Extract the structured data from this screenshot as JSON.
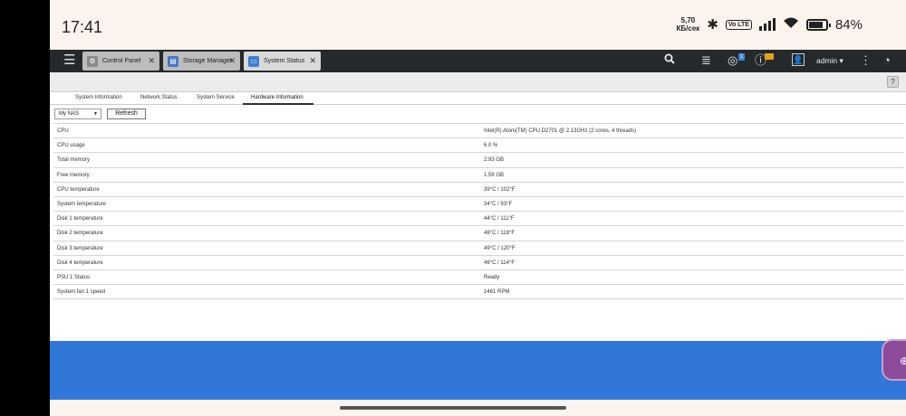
{
  "status_bar": {
    "time": "17:41",
    "speed_value": "5,70",
    "speed_unit": "КБ/сек",
    "volte_label": "Vo LTE",
    "battery_percent": "84%",
    "battery_level": 0.84
  },
  "topbar": {
    "tabs": [
      {
        "label": "Control Panel",
        "icon": "gear-icon",
        "active": false
      },
      {
        "label": "Storage Manager",
        "icon": "storage-icon",
        "active": false
      },
      {
        "label": "System Status",
        "icon": "monitor-icon",
        "active": true
      }
    ],
    "notification_badge": "1",
    "user": "admin"
  },
  "window": {
    "help_label": "?",
    "subtabs": [
      {
        "label": "System Information",
        "active": false
      },
      {
        "label": "Network Status",
        "active": false
      },
      {
        "label": "System Service",
        "active": false
      },
      {
        "label": "Hardware Information",
        "active": true
      }
    ]
  },
  "controls": {
    "nas_select": "My NAS",
    "refresh_label": "Refresh"
  },
  "hardware": [
    {
      "label": "CPU",
      "value": "Intel(R) Atom(TM) CPU D2701 @ 2.13GHz (2 cores, 4 threads)"
    },
    {
      "label": "CPU usage",
      "value": "6.0 %"
    },
    {
      "label": "Total memory",
      "value": "2.93 GB"
    },
    {
      "label": "Free memory",
      "value": "1.59 GB"
    },
    {
      "label": "CPU temperature",
      "value": "39°C / 102°F"
    },
    {
      "label": "System temperature",
      "value": "34°C / 93°F"
    },
    {
      "label": "Disk 1 temperature",
      "value": "44°C / 111°F"
    },
    {
      "label": "Disk 2 temperature",
      "value": "48°C / 118°F"
    },
    {
      "label": "Disk 3 temperature",
      "value": "49°C / 120°F"
    },
    {
      "label": "Disk 4 temperature",
      "value": "46°C / 114°F"
    },
    {
      "label": "PSU 1 Status",
      "value": "Ready"
    },
    {
      "label": "System fan 1 speed",
      "value": "1461 RPM"
    }
  ],
  "colors": {
    "topbar": "#25292c",
    "blue_area": "#3177d8",
    "float_button": "#8e4a9b"
  }
}
